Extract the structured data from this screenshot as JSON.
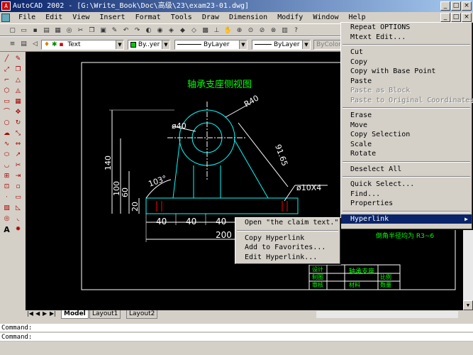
{
  "window": {
    "title": "AutoCAD 2002 - [G:\\Write_Book\\Doc\\高级\\23\\exam23-01.dwg]",
    "min_glyph": "_",
    "max_glyph": "□",
    "close_glyph": "×"
  },
  "menubar": {
    "items": [
      "File",
      "Edit",
      "View",
      "Insert",
      "Format",
      "Tools",
      "Draw",
      "Dimension",
      "Modify",
      "Window",
      "Help"
    ]
  },
  "properties_bar": {
    "layer_value": "Text",
    "color_value": "By..yer",
    "linetype_value": "ByLayer",
    "lineweight_value": "ByLayer",
    "plotstyle_value": "ByColor"
  },
  "drawing": {
    "title": "轴承支座侧视图",
    "dim_r40": "R40",
    "dim_d40": "ø40",
    "dim_140": "140",
    "dim_100": "100",
    "dim_60": "60",
    "dim_20": "20",
    "dim_103": "103°",
    "dim_9165": "91.65",
    "dim_holes": "ø10X4",
    "dim_40a": "40",
    "dim_40b": "40",
    "dim_40c": "40",
    "dim_200": "200",
    "note_text": "倒角半径均为 R3~6",
    "title_block": {
      "part_name": "轴承支座",
      "design": "设计",
      "draw": "制图",
      "review": "审核",
      "material": "材料",
      "scale": "比例",
      "quantity": "数量"
    }
  },
  "tabs": [
    "Model",
    "Layout1",
    "Layout2"
  ],
  "command_lines": [
    "Command:",
    "Command:"
  ],
  "context_menu": {
    "items": [
      {
        "label": "Repeat OPTIONS",
        "state": "enabled"
      },
      {
        "label": "Mtext Edit...",
        "state": "enabled"
      },
      {
        "sep": true
      },
      {
        "label": "Cut",
        "state": "enabled"
      },
      {
        "label": "Copy",
        "state": "enabled"
      },
      {
        "label": "Copy with Base Point",
        "state": "enabled"
      },
      {
        "label": "Paste",
        "state": "enabled"
      },
      {
        "label": "Paste as Block",
        "state": "disabled"
      },
      {
        "label": "Paste to Original Coordinates",
        "state": "disabled"
      },
      {
        "sep": true
      },
      {
        "label": "Erase",
        "state": "enabled"
      },
      {
        "label": "Move",
        "state": "enabled"
      },
      {
        "label": "Copy Selection",
        "state": "enabled"
      },
      {
        "label": "Scale",
        "state": "enabled"
      },
      {
        "label": "Rotate",
        "state": "enabled"
      },
      {
        "sep": true
      },
      {
        "label": "Deselect All",
        "state": "enabled"
      },
      {
        "sep": true
      },
      {
        "label": "Quick Select...",
        "state": "enabled"
      },
      {
        "label": "Find...",
        "state": "enabled"
      },
      {
        "label": "Properties",
        "state": "enabled"
      },
      {
        "sep": true
      },
      {
        "label": "Hyperlink",
        "state": "highlighted",
        "submenu": true
      }
    ]
  },
  "hyperlink_submenu": {
    "items": [
      {
        "label": "Open \"the claim text.\"",
        "state": "enabled"
      },
      {
        "sep": true
      },
      {
        "label": "Copy Hyperlink",
        "state": "enabled"
      },
      {
        "label": "Add to Favorites...",
        "state": "enabled"
      },
      {
        "label": "Edit Hyperlink...",
        "state": "enabled"
      }
    ]
  },
  "colors": {
    "canvas_bg": "#000000",
    "cyan": "#00ffff",
    "green": "#00ff00",
    "white": "#ffffff",
    "red": "#ff0000",
    "menu_highlight": "#0a246a"
  }
}
